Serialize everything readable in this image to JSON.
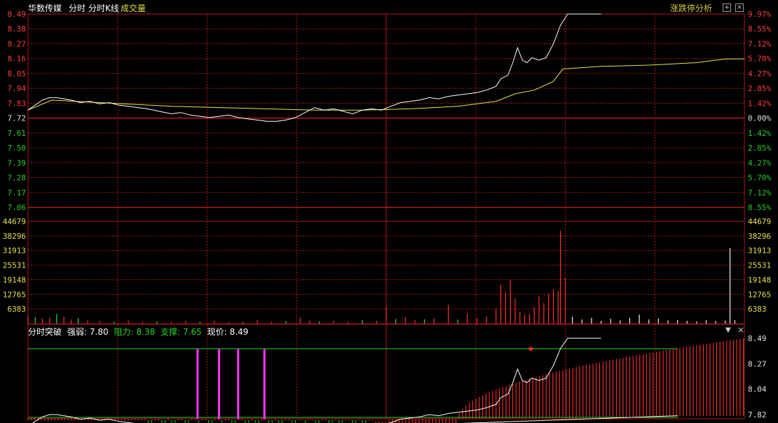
{
  "header": {
    "stock_name": "华数传媒",
    "tabs": [
      "分时",
      "分时K线",
      "成交量"
    ],
    "right_button": "涨跌停分析",
    "zoom_icon": "zoom-icon",
    "close_icon": "close-icon"
  },
  "indicator": {
    "name": "分时突破",
    "strength_label": "强弱:",
    "strength_value": "7.80",
    "resistance_label": "阻力:",
    "resistance_value": "8.38",
    "support_label": "支撑:",
    "support_value": "7.65",
    "price_label": "现价:",
    "price_value": "8.49",
    "menu_icon": "triangle-down-icon",
    "close_icon": "close-icon",
    "y_ticks": [
      "8.49",
      "8.27",
      "8.04",
      "7.82"
    ]
  },
  "price_axis": {
    "left_ticks": [
      "8.49",
      "8.38",
      "8.27",
      "8.16",
      "8.05",
      "7.94",
      "7.83",
      "7.72",
      "7.61",
      "7.50",
      "7.39",
      "7.28",
      "7.17",
      "7.06"
    ],
    "right_ticks": [
      "9.97%",
      "8.55%",
      "7.12%",
      "5.70%",
      "4.27%",
      "2.85%",
      "1.42%",
      "0.00%",
      "1.42%",
      "2.85%",
      "4.27%",
      "5.70%",
      "7.12%",
      "8.55%"
    ],
    "prev_close": 7.72
  },
  "volume_axis": {
    "ticks": [
      "44679",
      "38296",
      "31913",
      "25531",
      "19148",
      "12765",
      "6383"
    ]
  },
  "colors": {
    "background": "#000000",
    "grid": "#b01818",
    "price_line": "#ffffff",
    "avg_line": "#e6e64a",
    "up": "#ff3030",
    "down": "#28e028",
    "magenta": "#ff33ff",
    "axis_up": "#ff3c3c",
    "axis_down": "#22d022",
    "axis_neutral": "#e0e0e0",
    "volume_axis": "#e8e04a"
  },
  "chart_data": {
    "type": "line",
    "x_range": [
      "09:30",
      "15:00"
    ],
    "series": [
      {
        "points": [
          [
            0,
            7.72
          ],
          [
            3,
            7.76
          ],
          [
            6,
            7.8
          ],
          [
            9,
            7.82
          ],
          [
            12,
            7.82
          ],
          [
            15,
            7.81
          ],
          [
            18,
            7.8
          ],
          [
            22,
            7.78
          ],
          [
            26,
            7.79
          ],
          [
            30,
            7.77
          ],
          [
            34,
            7.78
          ],
          [
            38,
            7.76
          ],
          [
            42,
            7.75
          ],
          [
            46,
            7.74
          ],
          [
            50,
            7.73
          ],
          [
            55,
            7.71
          ],
          [
            60,
            7.69
          ],
          [
            64,
            7.7
          ],
          [
            68,
            7.68
          ],
          [
            72,
            7.67
          ],
          [
            76,
            7.66
          ],
          [
            80,
            7.67
          ],
          [
            84,
            7.68
          ],
          [
            88,
            7.66
          ],
          [
            92,
            7.65
          ],
          [
            96,
            7.64
          ],
          [
            100,
            7.63
          ],
          [
            104,
            7.63
          ],
          [
            108,
            7.64
          ],
          [
            112,
            7.66
          ],
          [
            116,
            7.7
          ],
          [
            120,
            7.74
          ],
          [
            124,
            7.72
          ],
          [
            128,
            7.73
          ],
          [
            132,
            7.71
          ],
          [
            136,
            7.69
          ],
          [
            140,
            7.72
          ],
          [
            144,
            7.73
          ],
          [
            148,
            7.72
          ],
          [
            152,
            7.75
          ],
          [
            156,
            7.78
          ],
          [
            160,
            7.79
          ],
          [
            164,
            7.8
          ],
          [
            168,
            7.82
          ],
          [
            172,
            7.81
          ],
          [
            176,
            7.83
          ],
          [
            180,
            7.84
          ],
          [
            184,
            7.85
          ],
          [
            188,
            7.86
          ],
          [
            192,
            7.88
          ],
          [
            196,
            7.91
          ],
          [
            198,
            7.97
          ],
          [
            201,
            8.0
          ],
          [
            203,
            8.1
          ],
          [
            205,
            8.22
          ],
          [
            207,
            8.12
          ],
          [
            209,
            8.1
          ],
          [
            211,
            8.14
          ],
          [
            214,
            8.12
          ],
          [
            217,
            8.14
          ],
          [
            220,
            8.25
          ],
          [
            223,
            8.4
          ],
          [
            226,
            8.49
          ],
          [
            228,
            8.49
          ],
          [
            240,
            8.49
          ]
        ]
      },
      {
        "points": [
          [
            0,
            7.72
          ],
          [
            10,
            7.8
          ],
          [
            20,
            7.79
          ],
          [
            40,
            7.77
          ],
          [
            60,
            7.75
          ],
          [
            80,
            7.74
          ],
          [
            100,
            7.73
          ],
          [
            120,
            7.72
          ],
          [
            140,
            7.72
          ],
          [
            160,
            7.73
          ],
          [
            180,
            7.75
          ],
          [
            196,
            7.79
          ],
          [
            204,
            7.85
          ],
          [
            212,
            7.88
          ],
          [
            220,
            7.95
          ],
          [
            224,
            8.05
          ],
          [
            240,
            8.07
          ],
          [
            260,
            8.08
          ],
          [
            280,
            8.1
          ],
          [
            292,
            8.13
          ],
          [
            300,
            8.13
          ]
        ]
      }
    ],
    "volume": {
      "bars": [
        {
          "t": 0,
          "v": 3500
        },
        {
          "t": 3,
          "v": 2800
        },
        {
          "t": 6,
          "v": 2200
        },
        {
          "t": 9,
          "v": 2500
        },
        {
          "t": 12,
          "v": 4200
        },
        {
          "t": 15,
          "v": 3000
        },
        {
          "t": 18,
          "v": 1800
        },
        {
          "t": 21,
          "v": 2400
        },
        {
          "t": 25,
          "v": 1500
        },
        {
          "t": 30,
          "v": 1200
        },
        {
          "t": 36,
          "v": 900
        },
        {
          "t": 42,
          "v": 1400
        },
        {
          "t": 48,
          "v": 800
        },
        {
          "t": 54,
          "v": 1000
        },
        {
          "t": 60,
          "v": 700
        },
        {
          "t": 66,
          "v": 1100
        },
        {
          "t": 72,
          "v": 900
        },
        {
          "t": 78,
          "v": 1300
        },
        {
          "t": 84,
          "v": 700
        },
        {
          "t": 90,
          "v": 600
        },
        {
          "t": 96,
          "v": 1500
        },
        {
          "t": 102,
          "v": 800
        },
        {
          "t": 108,
          "v": 1100
        },
        {
          "t": 114,
          "v": 2600
        },
        {
          "t": 118,
          "v": 1400
        },
        {
          "t": 122,
          "v": 900
        },
        {
          "t": 128,
          "v": 1200
        },
        {
          "t": 134,
          "v": 800
        },
        {
          "t": 140,
          "v": 1600
        },
        {
          "t": 146,
          "v": 1200
        },
        {
          "t": 150,
          "v": 7600
        },
        {
          "t": 154,
          "v": 2000
        },
        {
          "t": 158,
          "v": 2800
        },
        {
          "t": 162,
          "v": 1600
        },
        {
          "t": 166,
          "v": 1900
        },
        {
          "t": 170,
          "v": 2200
        },
        {
          "t": 176,
          "v": 8200
        },
        {
          "t": 180,
          "v": 1800
        },
        {
          "t": 184,
          "v": 4500
        },
        {
          "t": 188,
          "v": 2400
        },
        {
          "t": 192,
          "v": 3000
        },
        {
          "t": 196,
          "v": 6500
        },
        {
          "t": 198,
          "v": 17000
        },
        {
          "t": 200,
          "v": 13500
        },
        {
          "t": 202,
          "v": 19000
        },
        {
          "t": 204,
          "v": 11000
        },
        {
          "t": 206,
          "v": 5200
        },
        {
          "t": 208,
          "v": 4000
        },
        {
          "t": 210,
          "v": 4200
        },
        {
          "t": 212,
          "v": 7200
        },
        {
          "t": 214,
          "v": 12000
        },
        {
          "t": 216,
          "v": 9000
        },
        {
          "t": 218,
          "v": 13000
        },
        {
          "t": 220,
          "v": 15000
        },
        {
          "t": 222,
          "v": 14000
        },
        {
          "t": 223,
          "v": 40500
        },
        {
          "t": 225,
          "v": 20000
        },
        {
          "t": 228,
          "v": 3000
        },
        {
          "t": 232,
          "v": 1800
        },
        {
          "t": 236,
          "v": 2500
        },
        {
          "t": 240,
          "v": 1200
        },
        {
          "t": 244,
          "v": 2100
        },
        {
          "t": 248,
          "v": 1400
        },
        {
          "t": 252,
          "v": 2500
        },
        {
          "t": 256,
          "v": 3900
        },
        {
          "t": 260,
          "v": 1800
        },
        {
          "t": 264,
          "v": 2200
        },
        {
          "t": 268,
          "v": 1400
        },
        {
          "t": 272,
          "v": 1600
        },
        {
          "t": 276,
          "v": 1200
        },
        {
          "t": 280,
          "v": 900
        },
        {
          "t": 284,
          "v": 1500
        },
        {
          "t": 288,
          "v": 1100
        },
        {
          "t": 292,
          "v": 1300
        },
        {
          "t": 294,
          "v": 33000
        },
        {
          "t": 296,
          "v": 1500
        }
      ]
    }
  }
}
